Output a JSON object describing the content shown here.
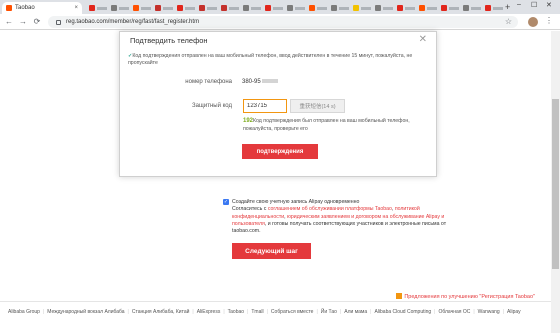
{
  "browser": {
    "tab_active_title": "Taobao",
    "tab_close": "×",
    "new_tab": "+",
    "url": "reg.taobao.com/member/reg/fast/fast_register.htm",
    "win_min": "–",
    "win_max": "☐",
    "win_close": "✕",
    "back": "←",
    "forward": "→",
    "reload": "⟳",
    "star": "☆",
    "menu": "⋮"
  },
  "modal": {
    "title": "Подтвердить телефон",
    "close": "✕",
    "info_tick": "✓",
    "info_text": "Код подтверждения отправлен на ваш мобильный телефон, ввод действителен в течение 15 минут, пожалуйста, не пропускайте",
    "phone_label": "номер телефона",
    "phone_value": "380-95",
    "code_label": "Защитный код",
    "code_value": "123715",
    "resend_label": "重获短信(14 s)",
    "sent_prefix": "192",
    "sent_text": "Код подтверждения был отправлен на ваш мобильный телефон, пожалуйста, проверьте его",
    "confirm_label": "подтверждения"
  },
  "alipay": {
    "check": "✓",
    "line1": "Создайте свою учетную запись Alipay одновременно",
    "line2_prefix": "Согласитесь с",
    "link1": "соглашением об обслуживании платформы Taobao",
    "link2": "политикой конфиденциальности",
    "link3": "юридическим заявлением и договором на обслуживание Alipay",
    "link4": "и пользователя",
    "tail": ", и готовы получать соответствующих участников и электронные письма от taobao.com."
  },
  "next_label": "Следующий шаг",
  "suggestion": "Предложения по улучшению \"Регистрация Taobao\"",
  "footer_links": [
    "Alibaba Group",
    "Международный вокзал Алибаба",
    "Станция Алибаба, Китай",
    "AliExpress",
    "Taobao",
    "Tmall",
    "Собраться вместе",
    "Йи Тао",
    "Али мама",
    "Alibaba Cloud Computing",
    "Облачная ОС",
    "Wanwang",
    "Alipay"
  ],
  "colors": {
    "accent": "#e4393c",
    "focus": "#f29611"
  }
}
